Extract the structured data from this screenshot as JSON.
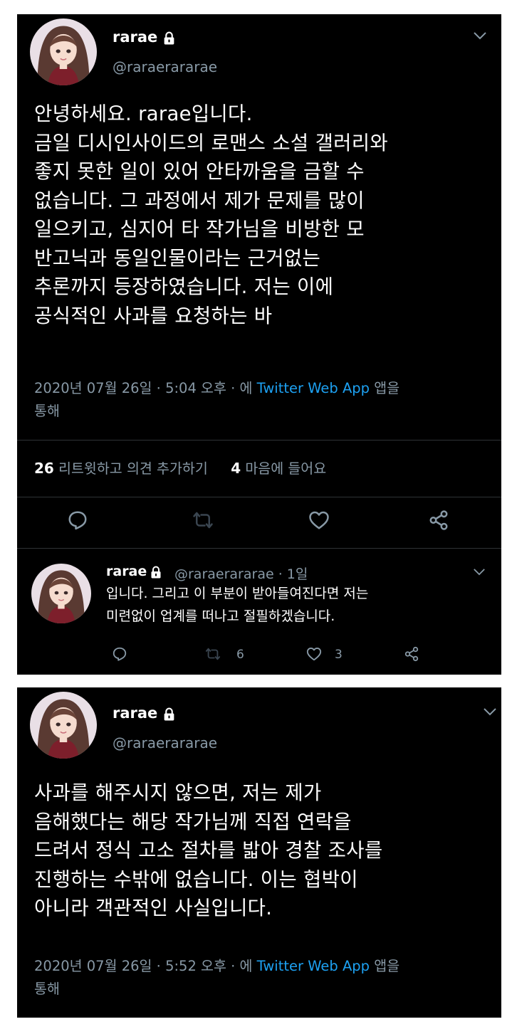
{
  "tweet1": {
    "name": "rarae",
    "handle": "@raraerararae",
    "text": "안녕하세요. rarae입니다.\n금일 디시인사이드의 로맨스 소설 갤러리와\n좋지 못한 일이 있어 안타까움을 금할 수\n없습니다. 그 과정에서 제가 문제를 많이\n일으키고, 심지어 타 작가님을 비방한 모\n반고닉과 동일인물이라는 근거없는\n추론까지 등장하였습니다. 저는 이에\n공식적인 사과를 요청하는 바",
    "timestamp": "2020년 07월 26일 · 5:04 오후 · 에",
    "source": "Twitter Web App",
    "suffix": "앱을",
    "suffix2": "통해",
    "retweets_count": "26",
    "retweets_label": "리트윗하고 의견 추가하기",
    "likes_count": "4",
    "likes_label": "마음에 들어요"
  },
  "reply": {
    "name": "rarae",
    "handle": "@raraerararae · 1일",
    "text": "입니다. 그리고 이 부분이 받아들여진다면 저는\n미련없이 업계를 떠나고 절필하겠습니다.",
    "retweet_count": "6",
    "like_count": "3"
  },
  "tweet2": {
    "name": "rarae",
    "handle": "@raraerararae",
    "text": "사과를 해주시지 않으면, 저는 제가\n음해했다는 해당 작가님께 직접 연락을\n드려서 정식 고소 절차를 밟아 경찰 조사를\n진행하는 수밖에 없습니다. 이는 협박이\n아니라 객관적인 사실입니다.",
    "timestamp": "2020년 07월 26일 · 5:52 오후 · 에",
    "source": "Twitter Web App",
    "suffix": "앱을",
    "suffix2": "통해"
  },
  "icons": {
    "lock": "lock-icon",
    "chevron": "chevron-down-icon",
    "reply": "reply-icon",
    "retweet": "retweet-icon",
    "like": "heart-icon",
    "share": "share-icon"
  },
  "colors": {
    "background": "#000000",
    "text": "#ffffff",
    "secondary": "#8899a6",
    "link": "#1da1f2"
  }
}
